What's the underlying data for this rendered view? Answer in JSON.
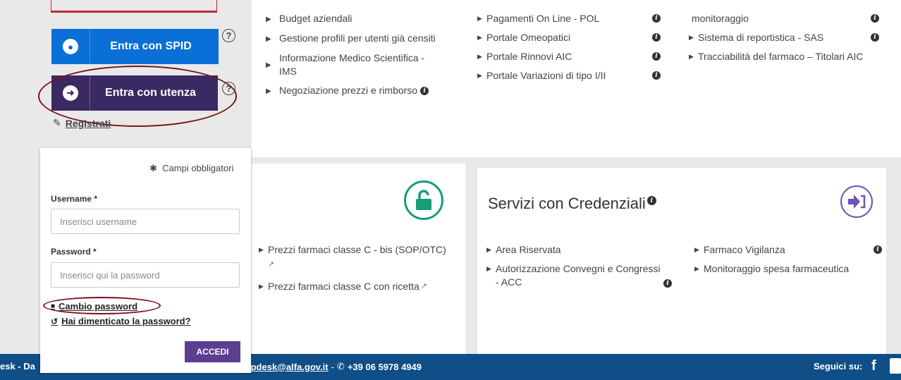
{
  "login_buttons": {
    "spid_label": "Entra con SPID",
    "utenza_label": "Entra con utenza",
    "help_symbol": "?",
    "registrati_label": "Registrati"
  },
  "top_services": {
    "col1": [
      {
        "label": "Budget aziendali"
      },
      {
        "label": "Gestione profili per utenti già censiti"
      },
      {
        "label": "Informazione Medico Scientifica - IMS"
      },
      {
        "label": "Negoziazione prezzi e rimborso"
      }
    ],
    "col2": [
      {
        "label": "Pagamenti On Line - POL"
      },
      {
        "label": "Portale Omeopatici"
      },
      {
        "label": "Portale Rinnovi AIC"
      },
      {
        "label": "Portale Variazioni di tipo I/II"
      }
    ],
    "col3": [
      {
        "label": "monitoraggio"
      },
      {
        "label": "Sistema di reportistica - SAS"
      },
      {
        "label": "Tracciabilità del farmaco – Titolari AIC"
      }
    ]
  },
  "mid_card": {
    "items": [
      {
        "label": "Prezzi farmaci classe C - bis (SOP/OTC)"
      },
      {
        "label": "Prezzi farmaci classe C con ricetta"
      }
    ]
  },
  "credentials_card": {
    "title": "Servizi con Credenziali",
    "col1": [
      {
        "label": "Area Riservata"
      },
      {
        "label": "Autorizzazione Convegni e Congressi - ACC"
      }
    ],
    "col2": [
      {
        "label": "Farmaco Vigilanza"
      },
      {
        "label": "Monitoraggio spesa farmaceutica"
      }
    ]
  },
  "login_form": {
    "required_note": "Campi obbligatori",
    "username_label": "Username",
    "username_placeholder": "Inserisci username",
    "password_label": "Password",
    "password_placeholder": "Inserisci qui la password",
    "change_password": "Cambio password",
    "forgot_password": "Hai dimenticato la password?",
    "submit": "ACCEDI"
  },
  "footer": {
    "left_text": "esk - Da",
    "email": "lpdesk@alfa.gov.it",
    "separator": "-",
    "phone": "+39 06 5978 4949",
    "follow": "Seguici su:"
  },
  "colors": {
    "spid_blue": "#0a6fd6",
    "utenza_purple": "#3a2a63",
    "accedi_purple": "#5c3f91",
    "footer_blue": "#0f4e87",
    "annotation_red": "#7a1014",
    "lock_green": "#1a9b7a",
    "arrow_violet": "#6a54b8"
  }
}
